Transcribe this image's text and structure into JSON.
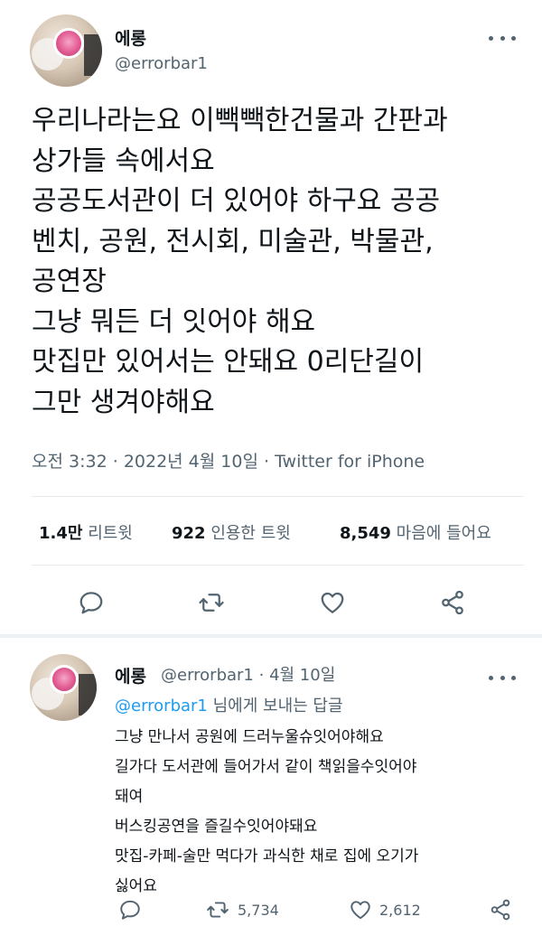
{
  "main_tweet": {
    "display_name": "에롱",
    "handle": "@errorbar1",
    "text_lines": [
      "우리나라는요 이빽빽한건물과 간판과",
      "상가들 속에서요",
      "공공도서관이 더 있어야 하구요 공공",
      "벤치, 공원, 전시회, 미술관, 박물관,",
      "공연장",
      "그냥 뭐든 더 잇어야 해요",
      "맛집만 있어서는 안돼요 0리단길이",
      "그만 생겨야해요"
    ],
    "time": "오전 3:32",
    "date": "2022년 4월 10일",
    "source": "Twitter for iPhone",
    "retweets_count": "1.4만",
    "retweets_label": "리트윗",
    "quotes_count": "922",
    "quotes_label": "인용한 트윗",
    "likes_count": "8,549",
    "likes_label": "마음에 들어요"
  },
  "reply_tweet": {
    "display_name": "에롱",
    "handle": "@errorbar1",
    "date": "4월 10일",
    "replying_to_handle": "@errorbar1",
    "replying_to_suffix": "님에게 보내는 답글",
    "text_lines": [
      "그냥 만나서 공원에 드러누울슈잇어야해요",
      "길가다 도서관에 들어가서 같이 책읽을수잇어야",
      "돼여",
      "버스킹공연을 즐길수잇어야돼요",
      "맛집-카페-술만 먹다가 과식한 채로 집에 오기가",
      "싫어요"
    ],
    "retweet_count": "5,734",
    "like_count": "2,612"
  },
  "icons": {
    "more": "more-horizontal-icon",
    "reply": "reply-icon",
    "retweet": "retweet-icon",
    "like": "heart-icon",
    "share": "share-icon"
  },
  "colors": {
    "text": "#0f1419",
    "secondary": "#536471",
    "link": "#1d9bf0",
    "divider": "#e6ecf0"
  }
}
